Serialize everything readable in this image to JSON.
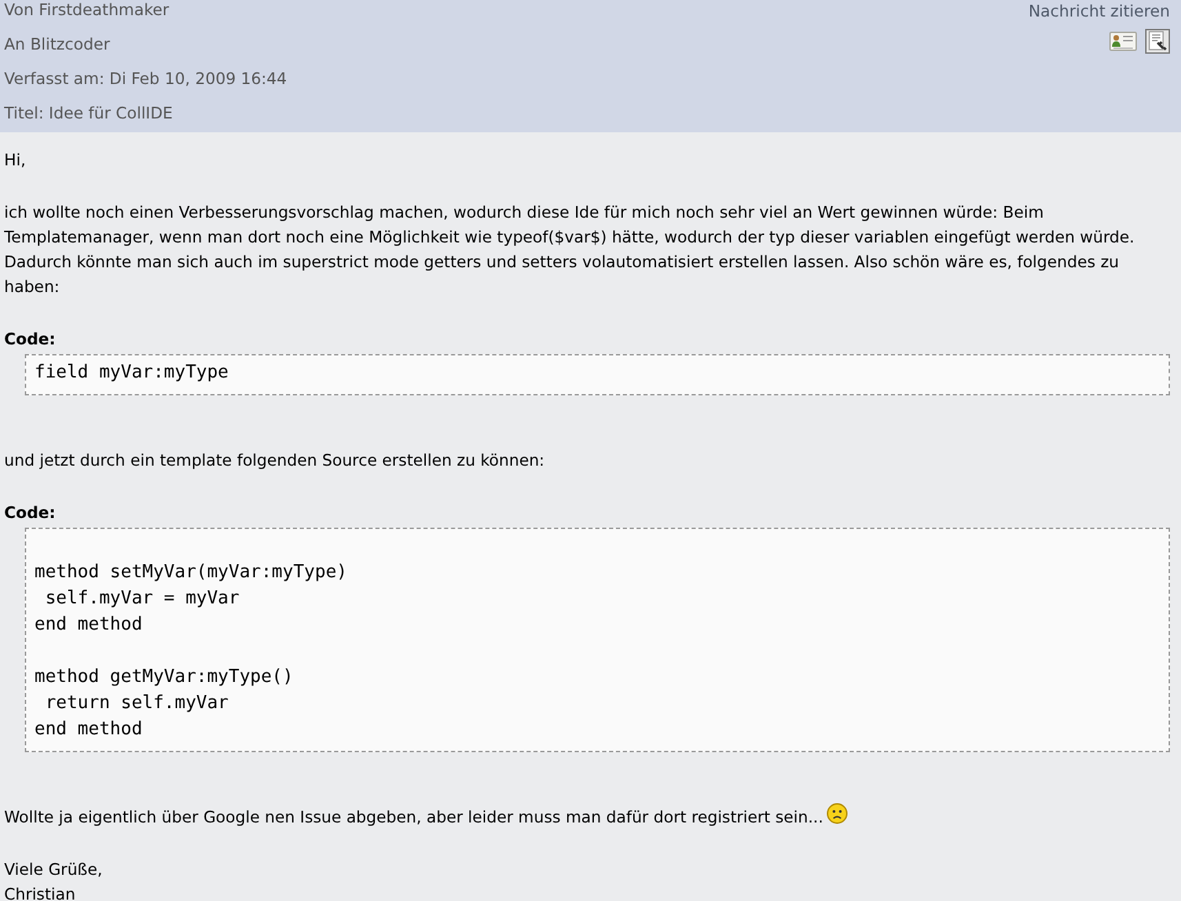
{
  "post_header": {
    "lines": [
      "Von Firstdeathmaker",
      "An Blitzcoder",
      "Verfasst am: Di Feb 10, 2009 16:44",
      "Titel: Idee für CollIDE"
    ],
    "quote_link": "Nachricht zitieren"
  },
  "body": [
    {
      "kind": "text",
      "text": "Hi,"
    },
    {
      "kind": "text",
      "text": "ich wollte noch einen Verbesserungsvorschlag machen, wodurch diese Ide für mich noch sehr viel an Wert gewinnen würde: Beim Templatemanager, wenn man dort noch eine Möglichkeit wie typeof($var$) hätte, wodurch der typ dieser variablen eingefügt werden würde. Dadurch könnte man sich auch im superstrict mode getters und setters volautomatisiert erstellen lassen. Also schön wäre es, folgendes zu haben:"
    },
    {
      "kind": "code",
      "label": "Code:",
      "leading_blank": false,
      "groups": [
        [
          "field myVar:myType"
        ]
      ]
    },
    {
      "kind": "text",
      "text": "und jetzt durch ein template folgenden Source erstellen zu können:"
    },
    {
      "kind": "code",
      "label": "Code:",
      "leading_blank": true,
      "groups": [
        [
          "method setMyVar(myVar:myType)",
          " self.myVar = myVar",
          "end method"
        ],
        [
          "method getMyVar:myType()",
          " return self.myVar",
          "end method"
        ]
      ]
    },
    {
      "kind": "text",
      "text": "Wollte ja eigentlich über Google nen Issue abgeben, aber leider muss man dafür dort registriert sein...",
      "emoticon": true
    },
    {
      "kind": "lines",
      "lines": [
        "Viele Grüße,",
        "Christian"
      ]
    }
  ]
}
